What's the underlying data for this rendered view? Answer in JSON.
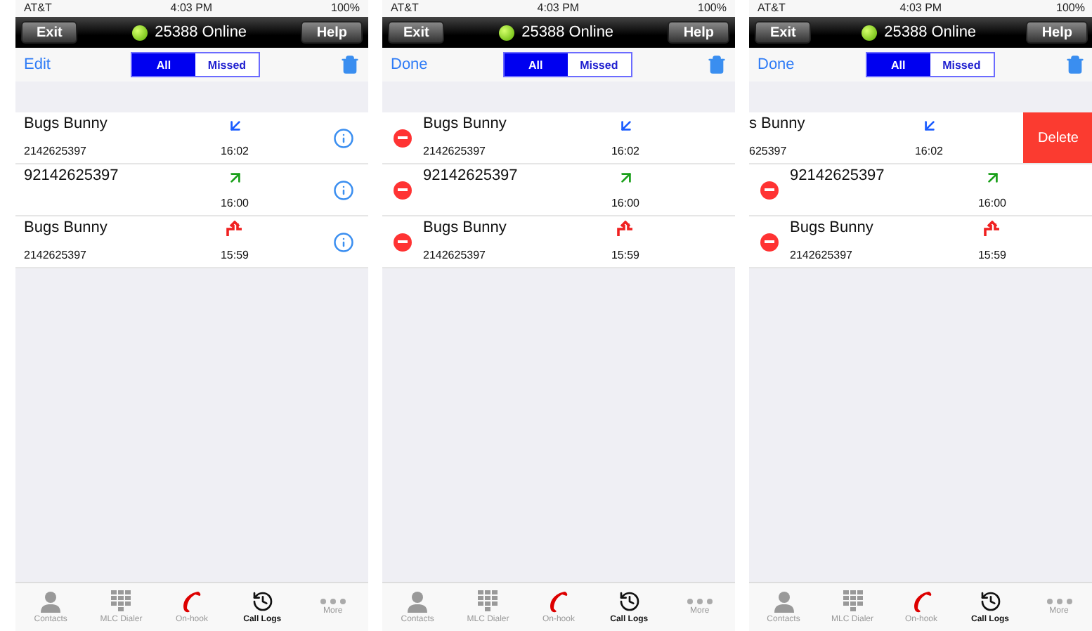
{
  "panels": [
    {
      "status_bar": {
        "carrier": "AT&T",
        "time": "4:03 PM",
        "battery": "100%"
      },
      "nav": {
        "left": "Exit",
        "status": "25388 Online",
        "right": "Help"
      },
      "toolbar": {
        "action": "Edit",
        "segments": [
          {
            "label": "All",
            "selected": true
          },
          {
            "label": "Missed",
            "selected": false
          }
        ]
      },
      "editing": false,
      "rows": [
        {
          "name": "Bugs Bunny",
          "number": "2142625397",
          "time": "16:02",
          "kind": "incoming",
          "swiped": false
        },
        {
          "name": "92142625397",
          "time": "16:00",
          "kind": "outgoing",
          "swiped": false
        },
        {
          "name": "Bugs Bunny",
          "number": "2142625397",
          "time": "15:59",
          "kind": "rejected",
          "swiped": false
        }
      ],
      "tabs": [
        {
          "label": "Contacts",
          "kind": "contacts",
          "selected": false
        },
        {
          "label": "MLC Dialer",
          "kind": "dialer",
          "selected": false
        },
        {
          "label": "On-hook",
          "kind": "hook",
          "selected": false
        },
        {
          "label": "Call Logs",
          "kind": "logs",
          "selected": true
        },
        {
          "label": "More",
          "kind": "more",
          "selected": false
        }
      ]
    },
    {
      "status_bar": {
        "carrier": "AT&T",
        "time": "4:03 PM",
        "battery": "100%"
      },
      "nav": {
        "left": "Exit",
        "status": "25388 Online",
        "right": "Help"
      },
      "toolbar": {
        "action": "Done",
        "segments": [
          {
            "label": "All",
            "selected": true
          },
          {
            "label": "Missed",
            "selected": false
          }
        ]
      },
      "editing": true,
      "rows": [
        {
          "name": "Bugs Bunny",
          "number": "2142625397",
          "time": "16:02",
          "kind": "incoming",
          "swiped": false
        },
        {
          "name": "92142625397",
          "time": "16:00",
          "kind": "outgoing",
          "swiped": false
        },
        {
          "name": "Bugs Bunny",
          "number": "2142625397",
          "time": "15:59",
          "kind": "rejected",
          "swiped": false
        }
      ],
      "tabs": [
        {
          "label": "Contacts",
          "kind": "contacts",
          "selected": false
        },
        {
          "label": "MLC Dialer",
          "kind": "dialer",
          "selected": false
        },
        {
          "label": "On-hook",
          "kind": "hook",
          "selected": false
        },
        {
          "label": "Call Logs",
          "kind": "logs",
          "selected": true
        },
        {
          "label": "More",
          "kind": "more",
          "selected": false
        }
      ]
    },
    {
      "status_bar": {
        "carrier": "AT&T",
        "time": "4:03 PM",
        "battery": "100%"
      },
      "nav": {
        "left": "Exit",
        "status": "25388 Online",
        "right": "Help"
      },
      "toolbar": {
        "action": "Done",
        "segments": [
          {
            "label": "All",
            "selected": true
          },
          {
            "label": "Missed",
            "selected": false
          }
        ]
      },
      "editing": true,
      "rows": [
        {
          "name": "s Bunny",
          "number": "625397",
          "time": "16:02",
          "kind": "incoming",
          "swiped": true,
          "delete_label": "Delete"
        },
        {
          "name": "92142625397",
          "time": "16:00",
          "kind": "outgoing",
          "swiped": false
        },
        {
          "name": "Bugs Bunny",
          "number": "2142625397",
          "time": "15:59",
          "kind": "rejected",
          "swiped": false
        }
      ],
      "tabs": [
        {
          "label": "Contacts",
          "kind": "contacts",
          "selected": false
        },
        {
          "label": "MLC Dialer",
          "kind": "dialer",
          "selected": false
        },
        {
          "label": "On-hook",
          "kind": "hook",
          "selected": false
        },
        {
          "label": "Call Logs",
          "kind": "logs",
          "selected": true
        },
        {
          "label": "More",
          "kind": "more",
          "selected": false
        }
      ]
    }
  ]
}
